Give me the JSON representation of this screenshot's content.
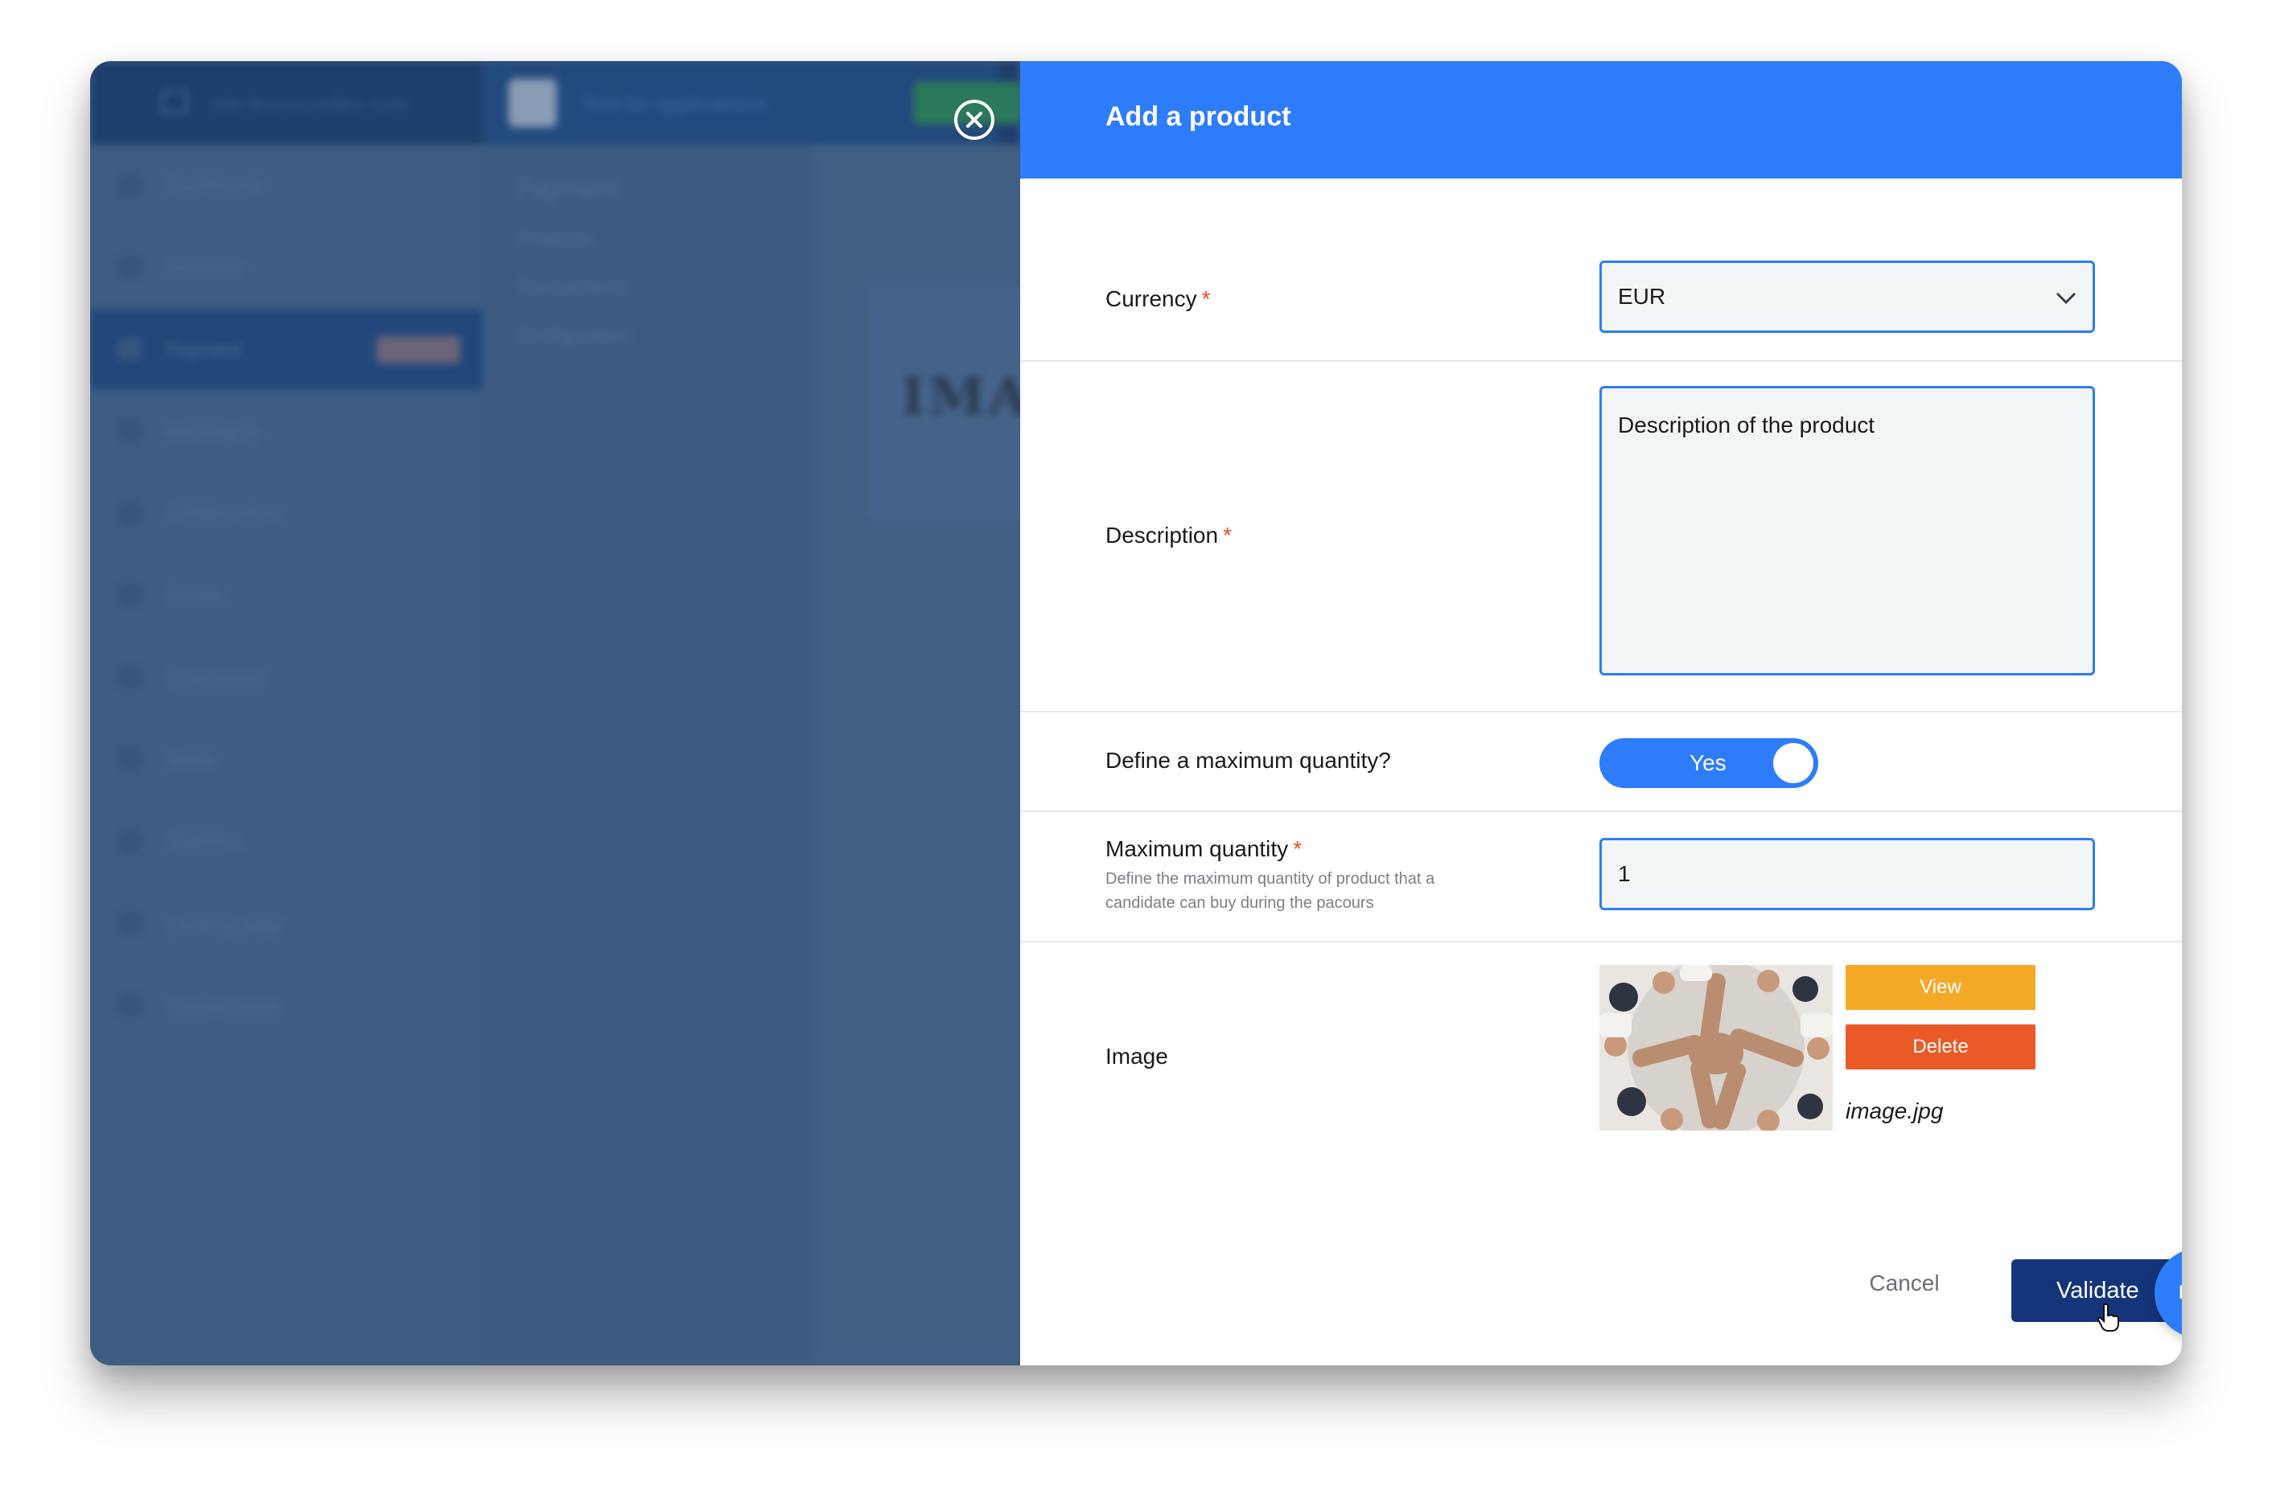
{
  "background_app": {
    "site_name": "site.lesnouvelles.com",
    "app_name": "Test for applications",
    "sidebar": {
      "items": [
        {
          "label": "Dashboard"
        },
        {
          "label": "Sessions"
        },
        {
          "label": "Payment",
          "active": true
        },
        {
          "label": "Messaging"
        },
        {
          "label": "Collaborators"
        },
        {
          "label": "Emails"
        },
        {
          "label": "Evaluations"
        },
        {
          "label": "Steps"
        },
        {
          "label": "Statistics"
        },
        {
          "label": "Landing page"
        },
        {
          "label": "Configuration"
        }
      ]
    },
    "subnav": {
      "title": "Payment",
      "items": [
        "Products",
        "Transactions",
        "Configuration"
      ]
    },
    "card_text": "IMA"
  },
  "panel": {
    "title": "Add a product",
    "currency": {
      "label": "Currency",
      "required_mark": "*",
      "value": "EUR"
    },
    "description": {
      "label": "Description",
      "required_mark": "*",
      "value": "Description of the product"
    },
    "max_quantity_toggle": {
      "label": "Define a maximum quantity?",
      "value": "Yes",
      "on": true
    },
    "max_quantity": {
      "label": "Maximum quantity",
      "required_mark": "*",
      "hint": "Define the maximum quantity of product that a candidate can buy during the pacours",
      "value": "1"
    },
    "image": {
      "label": "Image",
      "view_label": "View",
      "delete_label": "Delete",
      "filename": "image.jpg"
    },
    "actions": {
      "cancel_label": "Cancel",
      "validate_label": "Validate",
      "help_label": "Help"
    }
  },
  "colors": {
    "primary": "#2d7cfa",
    "validate": "#15357a",
    "view": "#f3a826",
    "delete": "#e95a26",
    "required": "#e2502a"
  }
}
